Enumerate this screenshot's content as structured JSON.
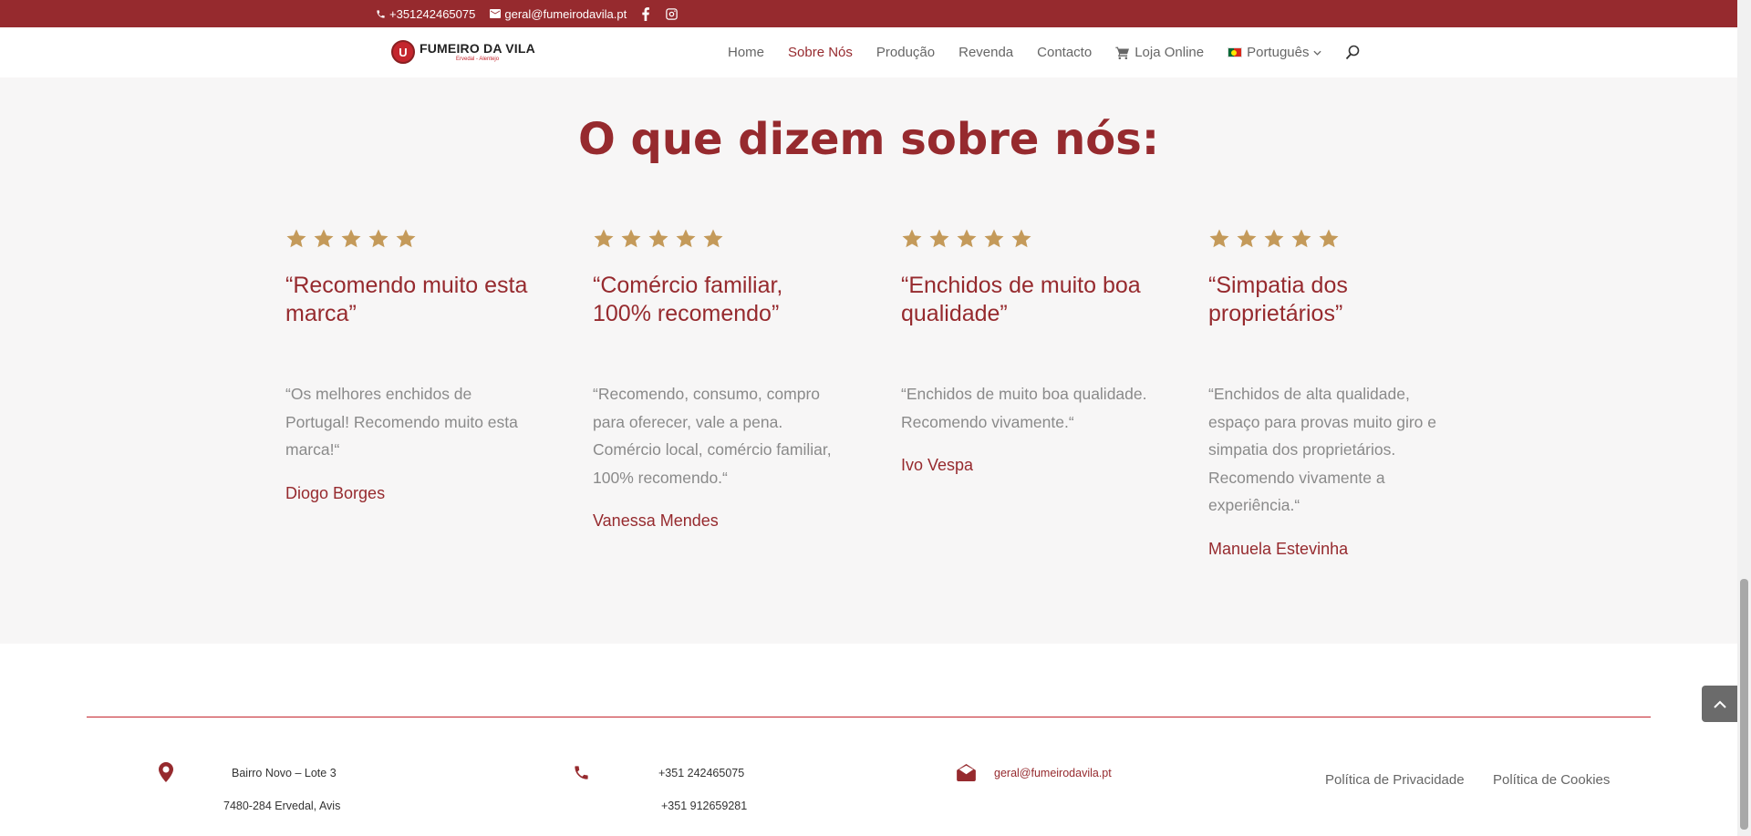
{
  "topbar": {
    "phone": "+351242465075",
    "email": "geral@fumeirodavila.pt"
  },
  "header": {
    "logo_letter": "U",
    "brand": "FUMEIRO DA VILA",
    "brand_sub": "Ervedal - Alentejo",
    "nav": [
      {
        "label": "Home",
        "active": false
      },
      {
        "label": "Sobre Nós",
        "active": true
      },
      {
        "label": "Produção",
        "active": false
      },
      {
        "label": "Revenda",
        "active": false
      },
      {
        "label": "Contacto",
        "active": false
      },
      {
        "label": "Loja Online",
        "active": false
      },
      {
        "label": "Português",
        "active": false
      }
    ]
  },
  "testimonials": {
    "title": "O que dizem sobre nós:",
    "rating": 5,
    "star_color": "#c49a5a",
    "cards": [
      {
        "title": "“Recomendo muito esta marca”",
        "body": "“Os melhores enchidos de Portugal! Recomendo muito esta marca!“",
        "author": "Diogo Borges"
      },
      {
        "title": "“Comércio familiar, 100% recomendo”",
        "body": "“Recomendo, consumo, compro para oferecer, vale a pena. Comércio local, comércio familiar, 100% recomendo.“",
        "author": "Vanessa Mendes"
      },
      {
        "title": "“Enchidos de muito boa qualidade”",
        "body": "“Enchidos de muito boa qualidade. Recomendo vivamente.“",
        "author": "Ivo Vespa"
      },
      {
        "title": "“Simpatia dos proprietários”",
        "body": "“Enchidos de alta qualidade, espaço para provas muito giro e simpatia dos proprietários. Recomendo vivamente a experiência.“",
        "author": "Manuela Estevinha"
      }
    ]
  },
  "footer": {
    "address_line1": "Bairro Novo – Lote 3",
    "address_line2": "7480-284 Ervedal, Avis",
    "phone1": "+351 242465075",
    "phone2": "+351 912659281",
    "email": "geral@fumeirodavila.pt",
    "privacy": "Política de Privacidade",
    "cookies": "Política de Cookies"
  },
  "colors": {
    "brand": "#962a2e",
    "accent": "#c4262e",
    "muted_text": "#8a8a8a"
  }
}
